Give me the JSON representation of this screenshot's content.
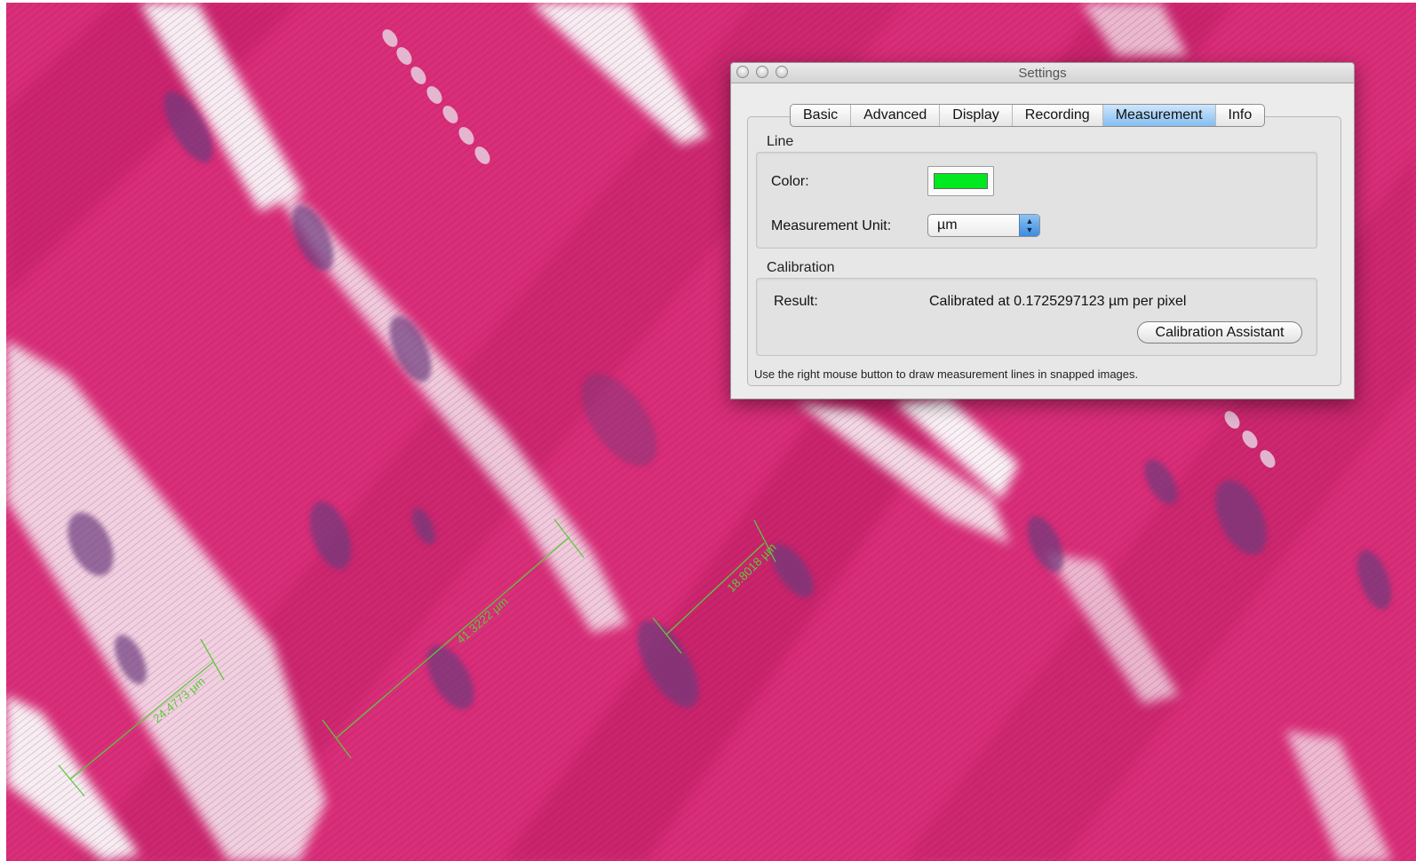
{
  "window": {
    "title": "Settings"
  },
  "tabs": [
    {
      "label": "Basic",
      "active": false
    },
    {
      "label": "Advanced",
      "active": false
    },
    {
      "label": "Display",
      "active": false
    },
    {
      "label": "Recording",
      "active": false
    },
    {
      "label": "Measurement",
      "active": true
    },
    {
      "label": "Info",
      "active": false
    }
  ],
  "line_group": {
    "label": "Line",
    "color_label": "Color:",
    "color_value": "#00e81f",
    "unit_label": "Measurement Unit:",
    "unit_value": "µm"
  },
  "calibration_group": {
    "label": "Calibration",
    "result_label": "Result:",
    "result_value": "Calibrated at 0.1725297123 µm per pixel",
    "assistant_button": "Calibration Assistant"
  },
  "footnote": "Use the right mouse button to draw measurement lines in snapped images.",
  "measurements": [
    {
      "label": "24.4773 µm"
    },
    {
      "label": "41.3222 µm"
    },
    {
      "label": "18.8018 µm"
    }
  ],
  "colors": {
    "tissue_base": "#d92e79",
    "tissue_dark": "#b01b5e",
    "nucleus": "#6e3a7d",
    "gap": "#f7f2f6",
    "measure_line": "#5dc93a",
    "tab_active": "#85bdf0"
  },
  "icons": {
    "window_close": "close-icon",
    "window_minimize": "minimize-icon",
    "window_zoom": "zoom-icon",
    "select_arrows": "up-down-arrows-icon"
  }
}
